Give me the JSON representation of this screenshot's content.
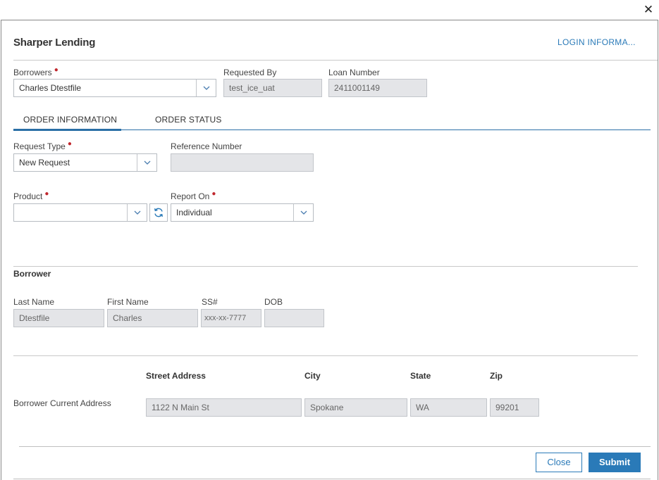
{
  "dialog": {
    "title": "Sharper Lending",
    "login_link": "LOGIN INFORMA...",
    "close_glyph": "✕"
  },
  "header": {
    "borrowers_label": "Borrowers",
    "borrowers_value": "Charles Dtestfile",
    "requested_by_label": "Requested By",
    "requested_by_value": "test_ice_uat",
    "loan_number_label": "Loan Number",
    "loan_number_value": "2411001149"
  },
  "tabs": [
    {
      "label": "ORDER INFORMATION",
      "active": true
    },
    {
      "label": "ORDER STATUS",
      "active": false
    }
  ],
  "order": {
    "request_type_label": "Request Type",
    "request_type_value": "New Request",
    "reference_number_label": "Reference Number",
    "reference_number_value": "",
    "product_label": "Product",
    "product_value": "",
    "report_on_label": "Report On",
    "report_on_value": "Individual"
  },
  "borrower": {
    "section_title": "Borrower",
    "last_name_label": "Last Name",
    "last_name_value": "Dtestfile",
    "first_name_label": "First Name",
    "first_name_value": "Charles",
    "ssn_label": "SS#",
    "ssn_value": "xxx-xx-7777",
    "dob_label": "DOB",
    "dob_value": ""
  },
  "address": {
    "row_label": "Borrower Current Address",
    "street_label": "Street Address",
    "street_value": "1122 N Main St",
    "city_label": "City",
    "city_value": "Spokane",
    "state_label": "State",
    "state_value": "WA",
    "zip_label": "Zip",
    "zip_value": "99201"
  },
  "footer": {
    "close_label": "Close",
    "submit_label": "Submit"
  },
  "colors": {
    "accent": "#2a7ab8",
    "required": "#c0272d",
    "readonly_bg": "#e4e5e8"
  },
  "icons": {
    "dropdown": "chevron-down-icon",
    "refresh": "refresh-icon",
    "close": "close-icon"
  }
}
